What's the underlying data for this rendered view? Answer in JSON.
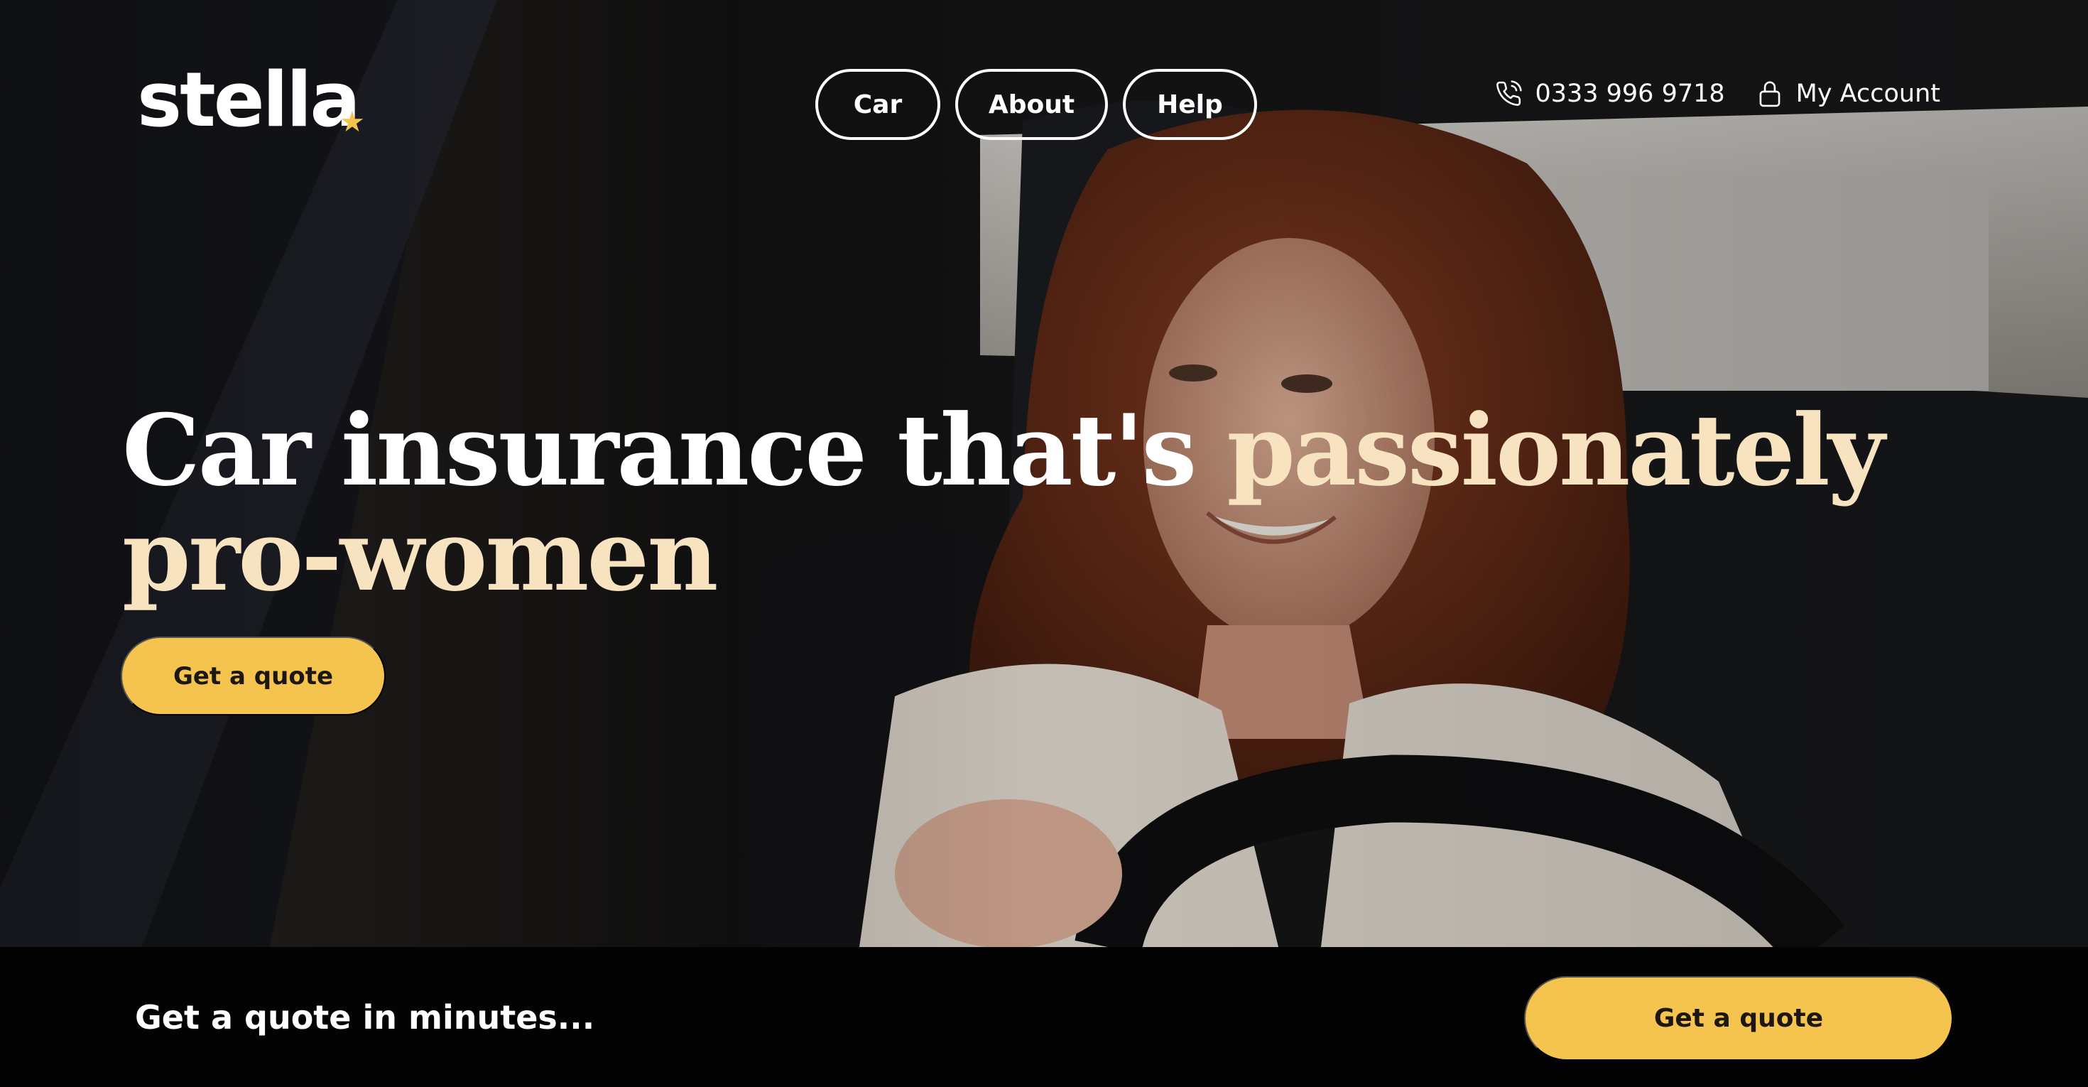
{
  "brand": {
    "name": "stella",
    "star_glyph": "★",
    "accent_color": "#f5c44e"
  },
  "nav": {
    "items": [
      "Car",
      "About",
      "Help"
    ]
  },
  "utility": {
    "phone_icon": "phone-icon",
    "phone": "0333 996 9718",
    "account_icon": "lock-icon",
    "account": "My Account"
  },
  "hero": {
    "headline_plain": "Car insurance that's ",
    "headline_accent": "passionately pro-women",
    "cta": "Get a quote",
    "image": "woman-driving-car-photo"
  },
  "bottom_bar": {
    "text": "Get a quote in minutes...",
    "cta": "Get a quote"
  },
  "colors": {
    "cta_background": "#f5c44e",
    "headline_accent": "#f8e3c1",
    "bottom_bar_background": "#030303"
  }
}
